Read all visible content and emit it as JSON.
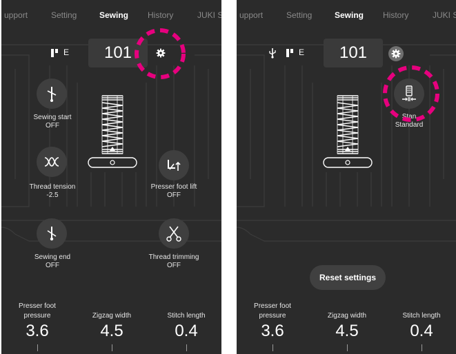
{
  "tabs": [
    "upport",
    "Setting",
    "Sewing",
    "History",
    "JUKI S"
  ],
  "right_tabs": [
    "upport",
    "Setting",
    "Sewing",
    "History",
    "JUKI S"
  ],
  "left": {
    "stitch_number": "101",
    "foot_letter": "E",
    "sewing_start": {
      "title": "Sewing start",
      "value": "OFF"
    },
    "thread_tension": {
      "title": "Thread tension",
      "value": "-2.5"
    },
    "presser_foot_lift": {
      "title": "Presser foot lift",
      "value": "OFF"
    },
    "sewing_end": {
      "title": "Sewing end",
      "value": "OFF"
    },
    "thread_trimming": {
      "title": "Thread trimming",
      "value": "OFF"
    },
    "presser_foot_pressure": {
      "title_line1": "Presser foot",
      "title_line2": "pressure",
      "value": "3.6"
    },
    "zigzag_width": {
      "title": "Zigzag width",
      "value": "4.5"
    },
    "stitch_length": {
      "title": "Stitch length",
      "value": "0.4"
    }
  },
  "right": {
    "stitch_number": "101",
    "foot_letter": "E",
    "stitch_option": {
      "title": "Standard",
      "overlay_text": "Standard",
      "partial_text": "Stan"
    },
    "reset_label": "Reset settings",
    "presser_foot_pressure": {
      "title_line1": "Presser foot",
      "title_line2": "pressure",
      "value": "3.6"
    },
    "zigzag_width": {
      "title": "Zigzag width",
      "value": "4.5"
    },
    "stitch_length": {
      "title": "Stitch length",
      "value": "0.4"
    }
  },
  "colors": {
    "background": "#2b2b2b",
    "highlight": "#e6007e",
    "line": "#3d3d3d"
  },
  "icons": [
    "usb-icon",
    "presser-foot-icon",
    "gear-icon",
    "sewing-start-icon",
    "thread-tension-icon",
    "presser-foot-lift-icon",
    "sewing-end-icon",
    "thread-trimming-icon",
    "stitch-width-icon"
  ]
}
